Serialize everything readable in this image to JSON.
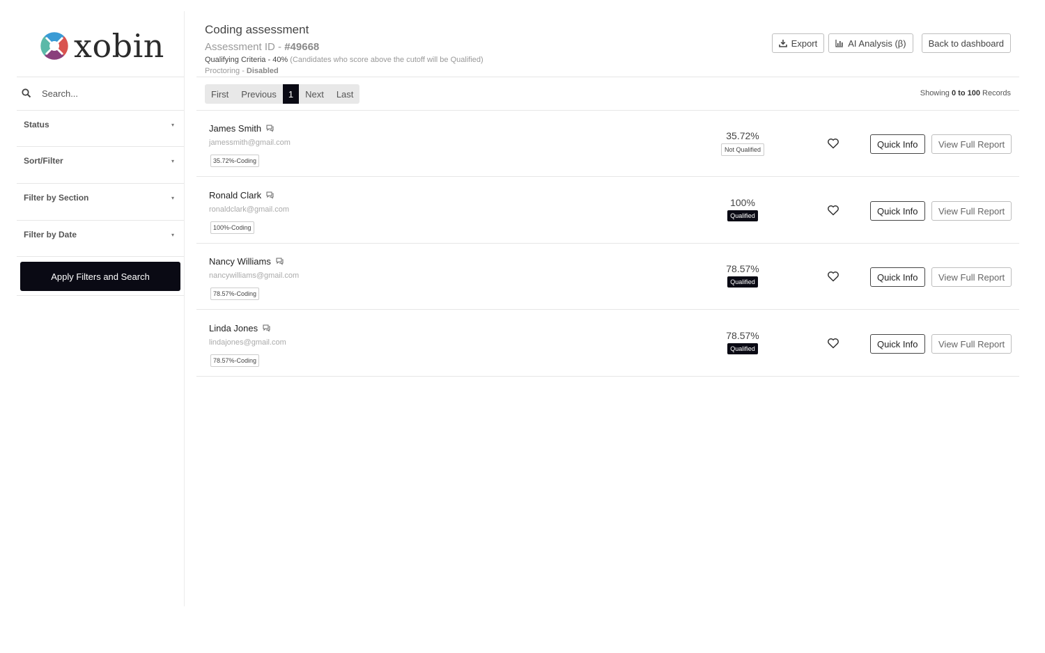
{
  "brand": {
    "name": "xobin"
  },
  "sidebar": {
    "search_placeholder": "Search...",
    "filters": [
      {
        "label": "Status"
      },
      {
        "label": "Sort/Filter"
      },
      {
        "label": "Filter by Section"
      },
      {
        "label": "Filter by Date"
      }
    ],
    "apply_label": "Apply Filters and Search"
  },
  "header": {
    "title": "Coding assessment",
    "assessment_id_label": "Assessment ID - ",
    "assessment_id": "#49668",
    "criteria_label": "Qualifying Criteria - 40%",
    "criteria_hint": "(Candidates who score above the cutoff will be Qualified)",
    "proctoring_label": "Proctoring - ",
    "proctoring_value": "Disabled"
  },
  "actions": {
    "export": "Export",
    "ai_analysis": "AI Analysis (β)",
    "back": "Back to dashboard"
  },
  "pagination": {
    "first": "First",
    "previous": "Previous",
    "current": "1",
    "next": "Next",
    "last": "Last"
  },
  "showing": {
    "prefix": "Showing",
    "range": "0 to 100",
    "suffix": "Records"
  },
  "candidates": [
    {
      "name": "James Smith",
      "email": "jamessmith@gmail.com",
      "tag": "35.72%-Coding",
      "score": "35.72%",
      "status": "Not Qualified",
      "qualified": false,
      "quick_info": "Quick Info",
      "full_report": "View Full Report"
    },
    {
      "name": "Ronald Clark",
      "email": "ronaldclark@gmail.com",
      "tag": "100%-Coding",
      "score": "100%",
      "status": "Qualified",
      "qualified": true,
      "quick_info": "Quick Info",
      "full_report": "View Full Report"
    },
    {
      "name": "Nancy Williams",
      "email": "nancywilliams@gmail.com",
      "tag": "78.57%-Coding",
      "score": "78.57%",
      "status": "Qualified",
      "qualified": true,
      "quick_info": "Quick Info",
      "full_report": "View Full Report"
    },
    {
      "name": "Linda Jones",
      "email": "lindajones@gmail.com",
      "tag": "78.57%-Coding",
      "score": "78.57%",
      "status": "Qualified",
      "qualified": true,
      "quick_info": "Quick Info",
      "full_report": "View Full Report"
    }
  ],
  "colors": {
    "primary_dark": "#0a0a14",
    "logo_blue": "#3a9bd5",
    "logo_teal": "#5bb9a8",
    "logo_purple": "#8a3f7c",
    "logo_red": "#d9534f"
  }
}
